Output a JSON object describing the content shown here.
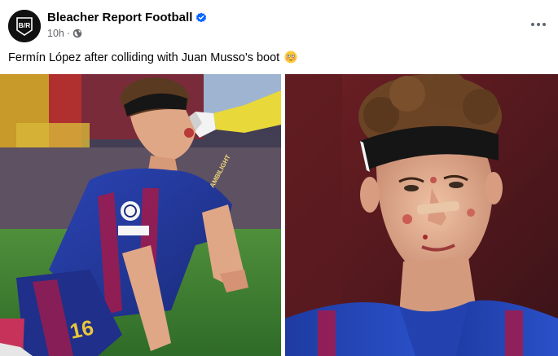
{
  "post": {
    "page_name": "Bleacher Report Football",
    "avatar_logo_text": "B/R",
    "verified_icon": "verified-badge-icon",
    "time": "10h",
    "separator": "·",
    "audience_icon": "globe-icon",
    "more_icon": "more-horizontal-icon",
    "caption": "Fermín López after colliding with Juan Musso's boot",
    "caption_emoji": "flushed-face-emoji",
    "photos": [
      {
        "icon": "photo-player-collision",
        "jersey_number": "16",
        "sponsor": "AMBILIGHT"
      },
      {
        "icon": "photo-player-closeup"
      }
    ]
  },
  "colors": {
    "verified_blue": "#0866ff",
    "meta_gray": "#65676b",
    "barca_blue": "#1f3fa8",
    "barca_garnet": "#a31a4a"
  }
}
